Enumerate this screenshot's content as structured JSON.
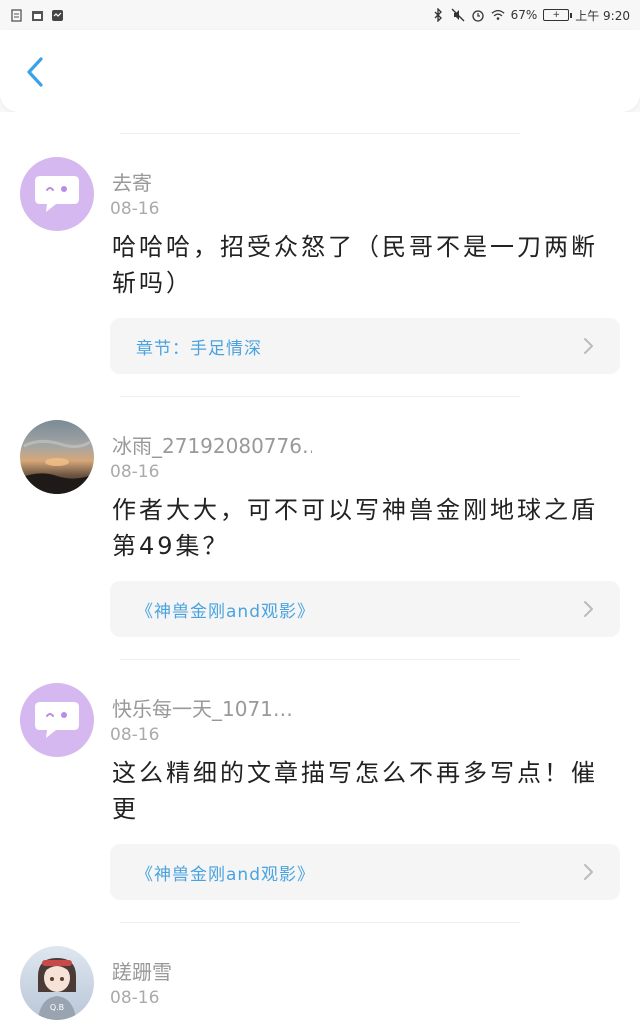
{
  "status_bar": {
    "battery_percent": "67%",
    "time": "上午 9:20"
  },
  "header": {
    "back_icon": "chevron-left-icon",
    "accent_color": "#3aa2e6"
  },
  "comments": [
    {
      "username": "去寄",
      "date": "08-16",
      "text": "哈哈哈，招受众怒了（民哥不是一刀两断斩吗）",
      "link": "章节：手足情深",
      "avatar": "default-chat-avatar"
    },
    {
      "username": "冰雨_27192080776…",
      "date": "08-16",
      "text": "作者大大，可不可以写神兽金刚地球之盾第49集？",
      "link": "《神兽金刚and观影》",
      "avatar": "sunset-photo-avatar"
    },
    {
      "username": "快乐每一天_1071…",
      "date": "08-16",
      "text": "这么精细的文章描写怎么不再多写点！催更",
      "link": "《神兽金刚and观影》",
      "avatar": "default-chat-avatar"
    },
    {
      "username": "蹉跚雪",
      "date": "08-16",
      "text": "",
      "link": "",
      "avatar": "anime-girl-avatar"
    }
  ]
}
